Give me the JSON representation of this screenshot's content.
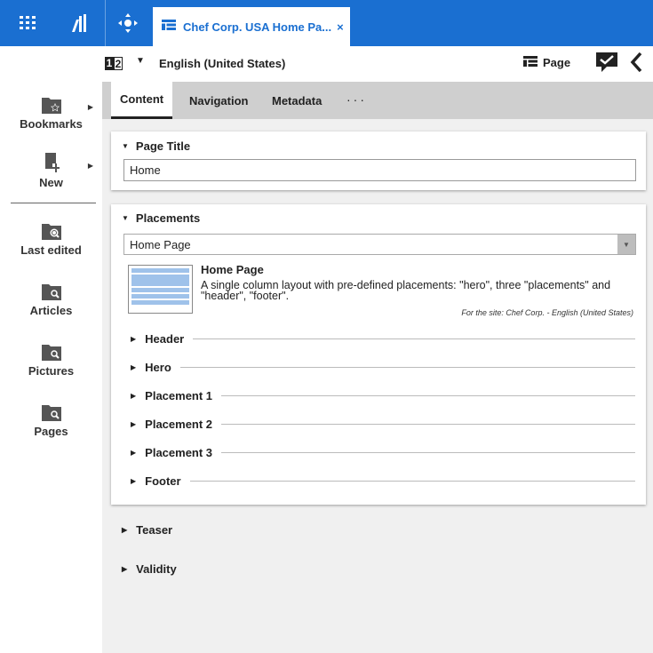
{
  "topbar": {
    "icons": [
      "grid-icon",
      "library-icon",
      "move-icon"
    ],
    "tab": {
      "label": "Chef Corp. USA Home Pa...",
      "close": "×"
    }
  },
  "subbar": {
    "language": "English (United States)",
    "lang_icon": {
      "a": "1",
      "b": "2"
    },
    "page_type": "Page"
  },
  "sidebar": {
    "items": [
      {
        "label": "Bookmarks",
        "has_submenu": true
      },
      {
        "label": "New",
        "has_submenu": true
      },
      {
        "label": "Last edited",
        "has_submenu": false
      },
      {
        "label": "Articles",
        "has_submenu": false
      },
      {
        "label": "Pictures",
        "has_submenu": false
      },
      {
        "label": "Pages",
        "has_submenu": false
      }
    ]
  },
  "content_tabs": {
    "items": [
      "Content",
      "Navigation",
      "Metadata"
    ],
    "active": "Content",
    "more": "···"
  },
  "page_title_section": {
    "heading": "Page Title",
    "value": "Home"
  },
  "placements_section": {
    "heading": "Placements",
    "selected_layout": "Home Page",
    "layout_name": "Home Page",
    "layout_description": "A single column layout with pre-defined placements: \"hero\", three \"placements\" and \"header\", \"footer\".",
    "layout_site": "For the site: Chef Corp. - English (United States)",
    "placements": [
      "Header",
      "Hero",
      "Placement 1",
      "Placement 2",
      "Placement 3",
      "Footer"
    ]
  },
  "collapsed_sections": [
    "Teaser",
    "Validity"
  ],
  "colors": {
    "brand": "#1a6fd1",
    "tab_bar": "#cfcfcf",
    "content_bg": "#f0f0f0"
  }
}
